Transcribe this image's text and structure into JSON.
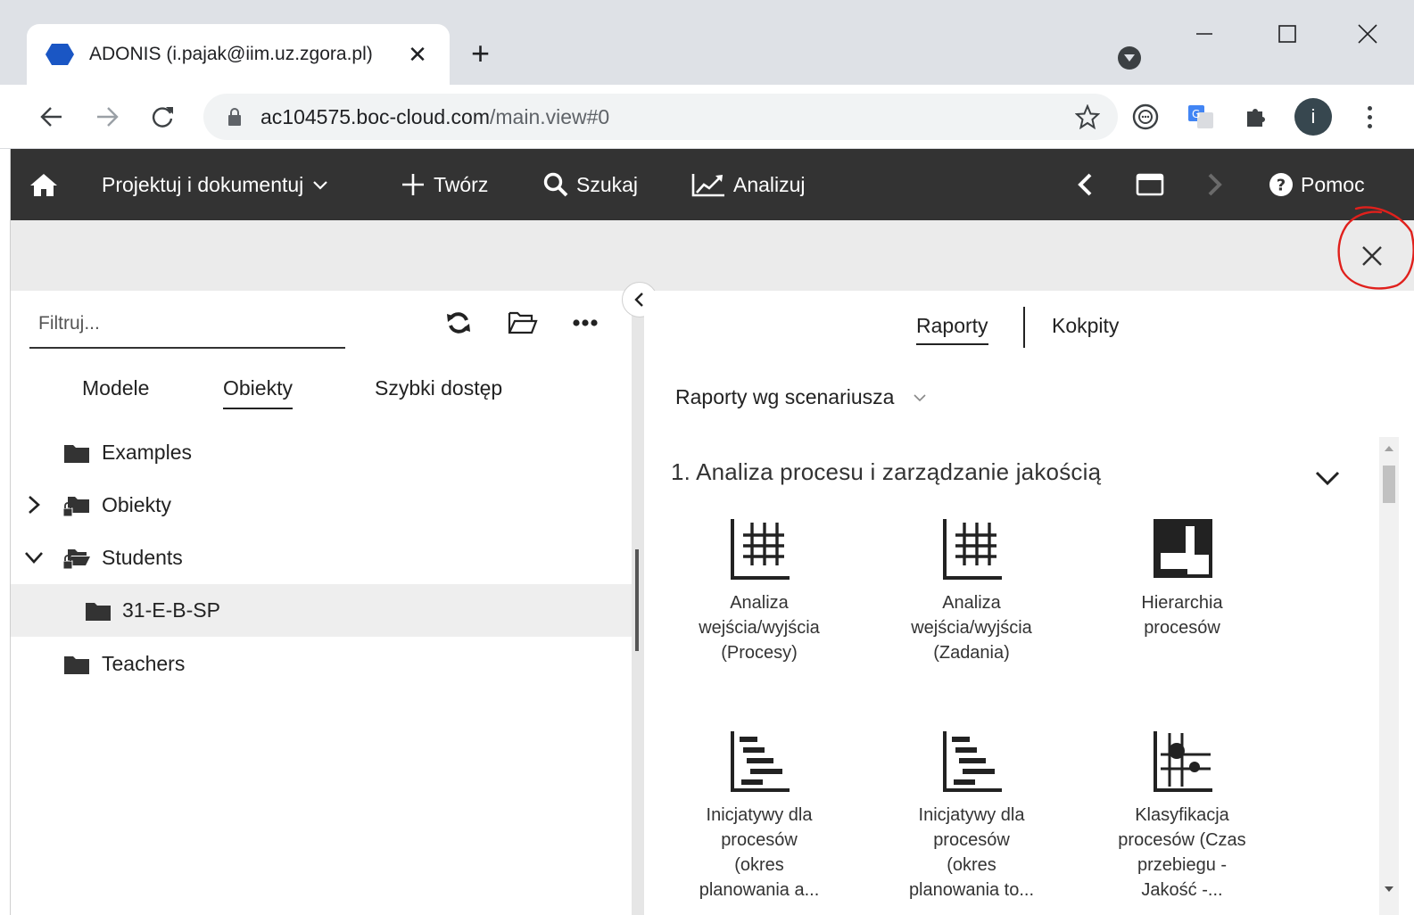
{
  "browser": {
    "tab_title": "ADONIS (i.pajak@iim.uz.zgora.pl)",
    "tab_close": "✕",
    "new_tab": "+",
    "url_host": "ac104575.boc-cloud.com",
    "url_path": "/main.view#0",
    "avatar_letter": "i",
    "favicon_color": "#1a56c4"
  },
  "appbar": {
    "design_label": "Projektuj i dokumentuj",
    "create_label": "Twórz",
    "search_label": "Szukaj",
    "analyze_label": "Analizuj",
    "help_label": "Pomoc",
    "background": "#333333"
  },
  "left_panel": {
    "filter_placeholder": "Filtruj...",
    "tabs": [
      {
        "label": "Modele",
        "active": false
      },
      {
        "label": "Obiekty",
        "active": true
      },
      {
        "label": "Szybki dostęp",
        "active": false
      }
    ],
    "tree": [
      {
        "label": "Examples",
        "expander": "none",
        "icon": "folder-icon",
        "locked": false,
        "selected": false
      },
      {
        "label": "Obiekty",
        "expander": "collapsed",
        "icon": "folder-locked-icon",
        "locked": true,
        "selected": false
      },
      {
        "label": "Students",
        "expander": "expanded",
        "icon": "folder-open-locked-icon",
        "locked": true,
        "selected": false
      },
      {
        "label": "31-E-B-SP",
        "expander": "none",
        "icon": "folder-icon",
        "locked": false,
        "selected": true
      },
      {
        "label": "Teachers",
        "expander": "none",
        "icon": "folder-icon",
        "locked": false,
        "selected": false
      }
    ]
  },
  "right_panel": {
    "tabs": [
      {
        "label": "Raporty",
        "active": true
      },
      {
        "label": "Kokpity",
        "active": false
      }
    ],
    "scenario_select": "Raporty wg scenariusza",
    "section_title": "1. Analiza procesu i zarządzanie jakością",
    "reports": [
      {
        "label": "Analiza wejścia/wyjścia (Procesy)",
        "icon": "matrix-icon",
        "lines": [
          "Analiza",
          "wejścia/wyjścia",
          "(Procesy)"
        ]
      },
      {
        "label": "Analiza wejścia/wyjścia (Zadania)",
        "icon": "matrix-icon",
        "lines": [
          "Analiza",
          "wejścia/wyjścia",
          "(Zadania)"
        ]
      },
      {
        "label": "Hierarchia procesów",
        "icon": "hierarchy-icon",
        "lines": [
          "Hierarchia",
          "procesów"
        ]
      },
      {
        "label": "Inicjatywy dla procesów (okres planowania a...",
        "icon": "gantt-icon",
        "lines": [
          "Inicjatywy dla",
          "procesów",
          "(okres",
          "planowania a..."
        ]
      },
      {
        "label": "Inicjatywy dla procesów (okres planowania to...",
        "icon": "gantt-icon",
        "lines": [
          "Inicjatywy dla",
          "procesów",
          "(okres",
          "planowania to..."
        ]
      },
      {
        "label": "Klasyfikacja procesów (Czas przebiegu - Jakość -...",
        "icon": "portfolio-icon",
        "lines": [
          "Klasyfikacja",
          "procesów (Czas",
          "przebiegu -",
          "Jakość -..."
        ]
      }
    ]
  },
  "annotation_color": "#e0201c"
}
